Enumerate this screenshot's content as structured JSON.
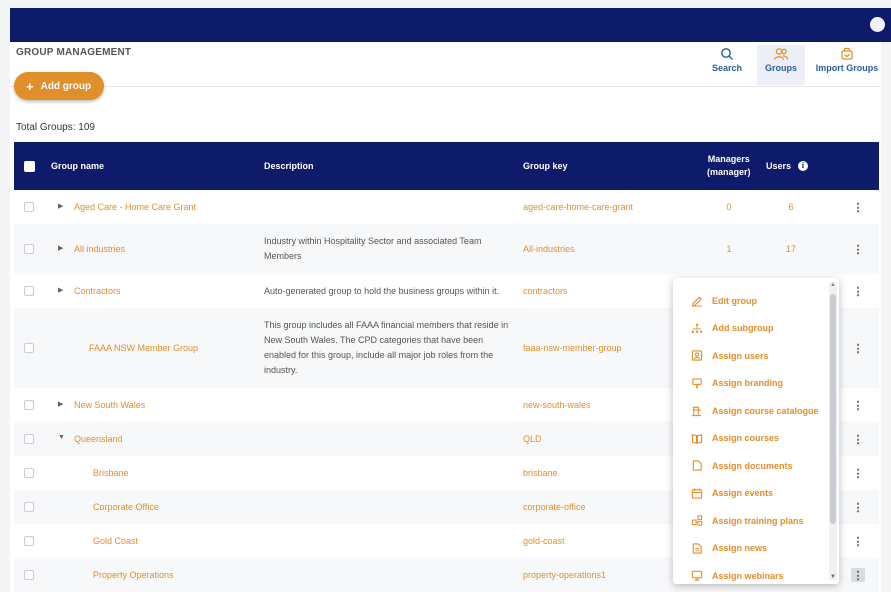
{
  "header": {
    "title": "GROUP MANAGEMENT",
    "add_label": "Add group",
    "tools": [
      {
        "label": "Search",
        "icon": "search-icon"
      },
      {
        "label": "Groups",
        "icon": "groups-icon"
      },
      {
        "label": "Import Groups",
        "icon": "import-icon"
      }
    ]
  },
  "total_text": "Total Groups: 109",
  "columns": {
    "name": "Group name",
    "description": "Description",
    "key": "Group key",
    "managers_line1": "Managers",
    "managers_line2": "(manager)",
    "users": "Users",
    "info_glyph": "i"
  },
  "rows": [
    {
      "name": "Aged Care - Home Care Grant",
      "description": "",
      "key": "aged-care-home-care-grant",
      "managers": "0",
      "users": "6",
      "caret": "▶"
    },
    {
      "name": "All industries",
      "description": "Industry within Hospitality Sector and associated Team Members",
      "key": "All-industries",
      "managers": "1",
      "users": "17",
      "caret": "▶"
    },
    {
      "name": "Contractors",
      "description": "Auto-generated group to hold the business groups within it.",
      "key": "contractors",
      "managers": "",
      "users": "",
      "caret": "▶"
    },
    {
      "name": "FAAA NSW Member Group",
      "description": "This group includes all FAAA financial members that reside in New South Wales. The CPD categories that have been enabled for this group, include all major job roles from the industry.",
      "key": "faaa-nsw-member-group",
      "managers": "",
      "users": "",
      "caret": ""
    },
    {
      "name": "New South Wales",
      "description": "",
      "key": "new-south-wales",
      "managers": "",
      "users": "",
      "caret": "▶"
    },
    {
      "name": "Queensland",
      "description": "",
      "key": "QLD",
      "managers": "",
      "users": "",
      "caret": "▼"
    },
    {
      "name": "Brisbane",
      "description": "",
      "key": "brisbane",
      "managers": "",
      "users": "",
      "caret": ""
    },
    {
      "name": "Corporate Office",
      "description": "",
      "key": "corporate-office",
      "managers": "",
      "users": "",
      "caret": ""
    },
    {
      "name": "Gold Coast",
      "description": "",
      "key": "gold-coast",
      "managers": "",
      "users": "",
      "caret": ""
    },
    {
      "name": "Property Operations",
      "description": "",
      "key": "property-operations1",
      "managers": "",
      "users": "",
      "caret": ""
    }
  ],
  "kebab_glyph": "⋮",
  "menu": {
    "items": [
      {
        "label": "Edit group",
        "icon": "pencil-icon"
      },
      {
        "label": "Add subgroup",
        "icon": "hierarchy-icon"
      },
      {
        "label": "Assign users",
        "icon": "user-card-icon"
      },
      {
        "label": "Assign branding",
        "icon": "brush-icon"
      },
      {
        "label": "Assign course catalogue",
        "icon": "catalogue-icon"
      },
      {
        "label": "Assign courses",
        "icon": "book-icon"
      },
      {
        "label": "Assign documents",
        "icon": "document-icon"
      },
      {
        "label": "Assign events",
        "icon": "calendar-icon"
      },
      {
        "label": "Assign training plans",
        "icon": "training-plan-icon"
      },
      {
        "label": "Assign news",
        "icon": "news-icon"
      },
      {
        "label": "Assign webinars",
        "icon": "monitor-icon"
      }
    ]
  },
  "colors": {
    "navy": "#0e1b6b",
    "accent": "#e08f2a",
    "link_blue": "#2a5d9f"
  }
}
